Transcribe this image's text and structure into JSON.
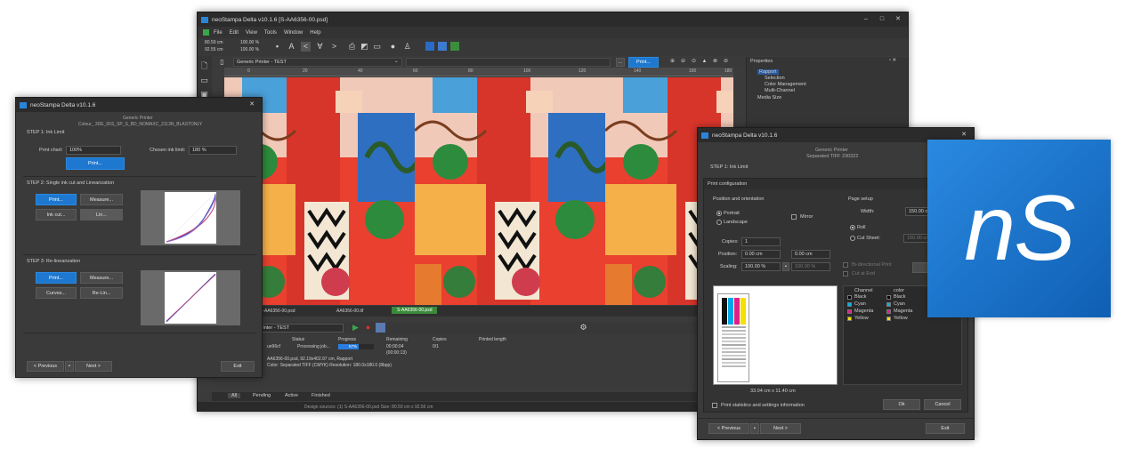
{
  "main_window": {
    "title": "neoStampa Delta  v10.1.6   [S-AA6356-00.psd]",
    "menu": [
      "File",
      "Edit",
      "View",
      "Tools",
      "Window",
      "Help"
    ],
    "readout": {
      "size1": "80.59 cm",
      "size2": "92.55 cm",
      "zoom1": "100.00 %",
      "zoom2": "100.00 %"
    },
    "printer_select": "Generic Printer - TEST",
    "print_button": "Print...",
    "ruler_ticks": [
      "0",
      "20",
      "40",
      "60",
      "80",
      "100",
      "120",
      "140",
      "160",
      "180"
    ],
    "properties": {
      "title": "Properties",
      "tree": [
        "Rapport",
        "Selection",
        "Color Management",
        "Multi-Channel",
        "Media Size"
      ]
    },
    "doc_tabs": [
      "S-AA6356-00.psd",
      "AA6356-00.tif",
      "S-AA6356-00.psd"
    ],
    "queue": {
      "printer_select": "Printer - TEST",
      "columns": [
        "Status",
        "Progress",
        "Remaining",
        "Copies",
        "Printed length"
      ],
      "row": {
        "name": "ue96cf",
        "status": "Processing job...",
        "progress_pct": 57,
        "progress_label": "57%",
        "remaining": "00:00:04",
        "remaining2": "(00:00:13)",
        "copies": "0/1"
      },
      "info1": "AA6356-00.psd, 92.19x402.97 cm, Rapport",
      "info2": "Color: Separated TIFF (CMYK)  Resolution: 180.0x180.0 (8bpp)"
    },
    "bottom_tabs": [
      "All",
      "Pending",
      "Active",
      "Finished"
    ],
    "status_bar": "Design sources: (1) S-AA6356-00.psd   Size: 80.59 cm x 92.56 cm"
  },
  "left_dialog": {
    "title": "neoStampa Delta  v10.1.6",
    "header1": "Generic Printer",
    "header2": "Colour_ 3DE_65S_SP_S_BD_NOMAXC_2113N_BLASTONLY",
    "step1": {
      "title": "STEP 1: Ink Limit",
      "print_chart_label": "Print chart:",
      "print_chart_value": "100%",
      "chosen_label": "Chosen ink limit:",
      "chosen_value": "180 %",
      "print_button": "Print..."
    },
    "step2": {
      "title": "STEP 2: Single ink cut and Linearization",
      "buttons": [
        "Print...",
        "Measure...",
        "Ink cut...",
        "Lin..."
      ]
    },
    "step3": {
      "title": "STEP 3: Re-linearization",
      "buttons": [
        "Print...",
        "Measure...",
        "Curves...",
        "Re-Lin..."
      ]
    },
    "nav": {
      "previous": "< Previous",
      "next": "Next >",
      "exit": "Exit"
    }
  },
  "right_dialog": {
    "title": "neoStampa Delta  v10.1.6",
    "header1": "Generic Printer",
    "header2": "Separated TIFF 230322",
    "step_label": "STEP 1: Ink Limit",
    "section_title": "Print configuration",
    "position": {
      "title": "Position and orientation",
      "portrait": "Portrait",
      "landscape": "Landscape",
      "mirror": "Mirror",
      "copies_label": "Copies:",
      "copies_value": "1",
      "position_label": "Position:",
      "position_x": "0.00 cm",
      "position_y": "0.00 cm",
      "scaling_label": "Scaling:",
      "scaling_value": "100.00 %",
      "scaling_value2": "100.00 %"
    },
    "page_setup": {
      "title": "Page setup",
      "width_label": "Width:",
      "width_value": "150.00 cm",
      "roll": "Roll",
      "cut_sheet": "Cut Sheet:",
      "cut_sheet_value": "150.00 cm",
      "bidirectional": "Bi-directional Print",
      "cut_at_end": "Cut at End",
      "add_button": "Ad"
    },
    "preview_size": "33.04 cm x 11.40 cm",
    "channels": {
      "col1": "Channel",
      "col2": "color",
      "rows": [
        {
          "channel": "Black",
          "color": "Black",
          "hex": "#000000"
        },
        {
          "channel": "Cyan",
          "color": "Cyan",
          "hex": "#00b4f0"
        },
        {
          "channel": "Magenta",
          "color": "Magenta",
          "hex": "#e0208a"
        },
        {
          "channel": "Yellow",
          "color": "Yellow",
          "hex": "#f5e000"
        }
      ]
    },
    "stats_label": "Print statistics and settings information",
    "ok": "Ok",
    "cancel": "Cancel",
    "nav": {
      "previous": "< Previous",
      "next": "Next >",
      "exit": "Exit"
    }
  },
  "logo": {
    "text": "nS",
    "color": "#1a6fc4"
  }
}
